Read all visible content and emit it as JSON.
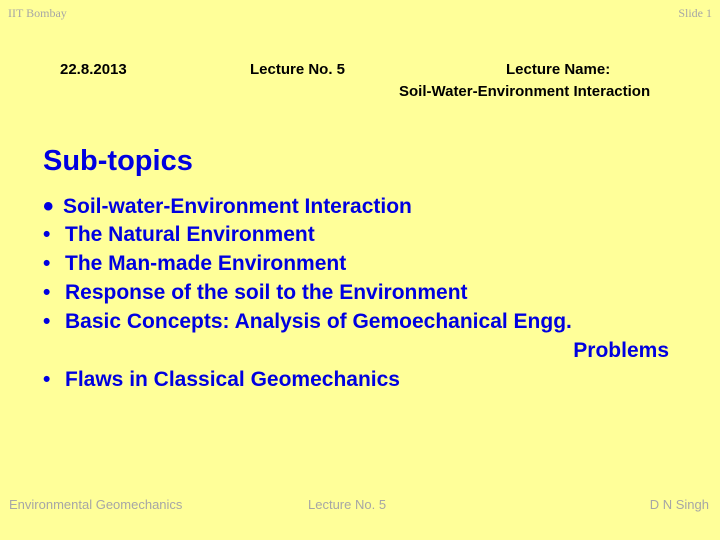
{
  "header": {
    "left": "IIT Bombay",
    "right": "Slide 1"
  },
  "info": {
    "date": "22.8.2013",
    "lecture_no": "Lecture No. 5",
    "lecture_name_label": "Lecture Name:",
    "lecture_name": "Soil-Water-Environment Interaction"
  },
  "content": {
    "title": "Sub-topics",
    "bullet_char": "•",
    "topics": [
      "Soil-water-Environment Interaction",
      "The Natural Environment",
      "The Man-made Environment",
      "Response of the soil to the Environment",
      "Basic Concepts: Analysis of Gemoechanical Engg.",
      "Flaws in Classical Geomechanics"
    ],
    "topic5_continuation": "Problems"
  },
  "footer": {
    "left": "Environmental Geomechanics",
    "center": "Lecture No. 5",
    "right": "D N Singh"
  }
}
